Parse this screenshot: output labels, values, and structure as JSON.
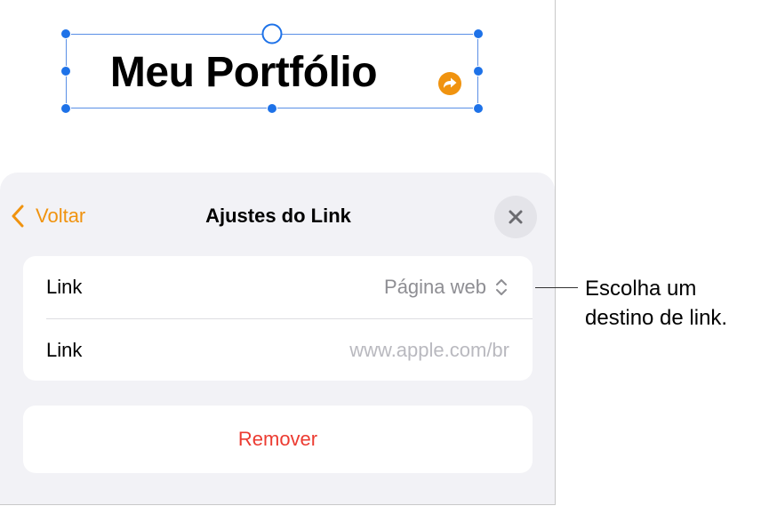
{
  "canvas": {
    "title_text": "Meu Portfólio"
  },
  "panel": {
    "back_label": "Voltar",
    "title": "Ajustes do Link",
    "close_icon": "xmark-icon",
    "rows": [
      {
        "label": "Link",
        "value": "Página web",
        "value_icon": "chevron-up-down-icon"
      },
      {
        "label": "Link",
        "placeholder": "www.apple.com/br"
      }
    ],
    "remove_label": "Remover"
  },
  "callout": {
    "line1": "Escolha um",
    "line2": "destino de link."
  },
  "colors": {
    "accent": "#f0930f",
    "selection": "#1e72e8",
    "destructive": "#ec3b31",
    "panel_bg": "#f2f2f6"
  }
}
